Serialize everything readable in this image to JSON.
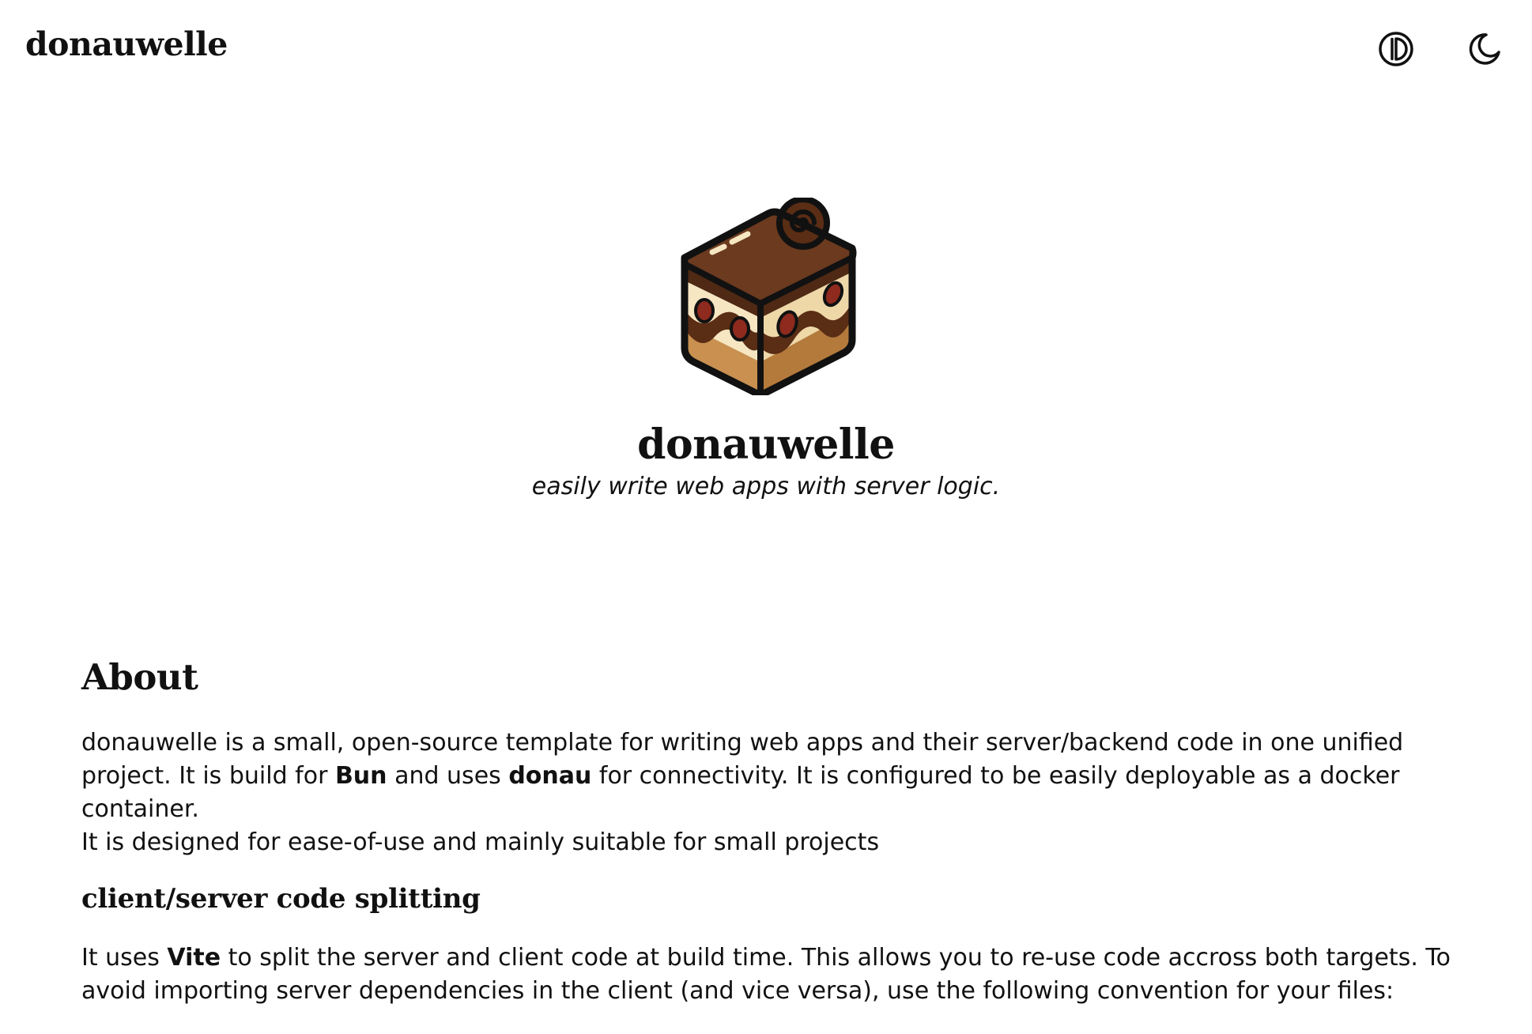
{
  "header": {
    "site_title": "donauwelle",
    "contrast_icon": "contrast-icon",
    "theme_icon": "moon-icon"
  },
  "hero": {
    "logo_icon": "cake-logo",
    "title": "donauwelle",
    "subtitle": "easily write web apps with server logic."
  },
  "about": {
    "heading": "About",
    "p1_a": "donauwelle is a small, open-source template for writing web apps and their server/backend code in one unified project. It is build for ",
    "p1_bun": "Bun",
    "p1_b": " and uses ",
    "p1_donau": "donau",
    "p1_c": " for connectivity. It is configured to be easily deployable as a docker container.",
    "p2": "It is designed for ease-of-use and mainly suitable for small projects"
  },
  "splitting": {
    "heading": "client/server code splitting",
    "p_a": "It uses ",
    "p_vite": "Vite",
    "p_b": " to split the server and client code at build time. This allows you to re-use code accross both targets. To avoid importing server dependencies in the client (and vice versa), use the following convention for your files:"
  },
  "colors": {
    "chocolate": "#6b3a1f",
    "cream": "#f6e6c2",
    "sponge": "#c99050",
    "cherry": "#8e2a1e"
  }
}
